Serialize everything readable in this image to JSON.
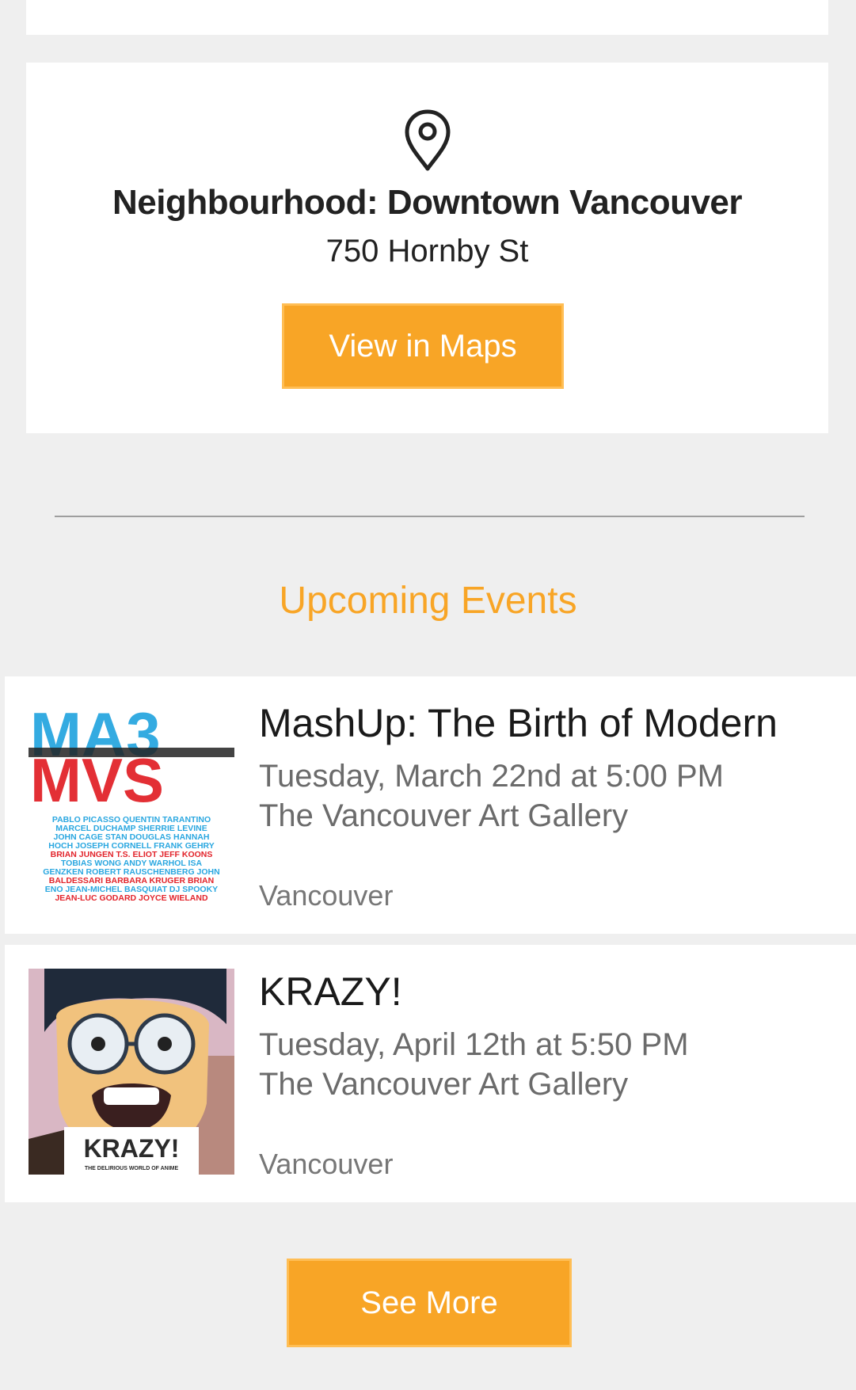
{
  "location": {
    "icon": "map-pin-icon",
    "neighbourhood": "Neighbourhood: Downtown Vancouver",
    "address": "750 Hornby St",
    "maps_button": "View in Maps"
  },
  "upcoming": {
    "title": "Upcoming Events",
    "events": [
      {
        "title": "MashUp: The Birth of Modern",
        "date": "Tuesday, March 22nd at 5:00 PM",
        "venue": "The Vancouver Art Gallery",
        "city": "Vancouver",
        "poster": {
          "logo_top": "MA3",
          "logo_bottom": "MVS",
          "names": [
            "PABLO PICASSO QUENTIN TARANTINO",
            "MARCEL DUCHAMP SHERRIE LEVINE",
            "JOHN CAGE STAN DOUGLAS HANNAH",
            "HOCH JOSEPH CORNELL FRANK GEHRY",
            "BRIAN JUNGEN T.S. ELIOT JEFF KOONS",
            "TOBIAS WONG ANDY WARHOL ISA",
            "GENZKEN ROBERT RAUSCHENBERG JOHN",
            "BALDESSARI BARBARA KRUGER BRIAN",
            "ENO JEAN-MICHEL BASQUIAT DJ SPOOKY",
            "JEAN-LUC GODARD JOYCE WIELAND"
          ]
        }
      },
      {
        "title": "KRAZY!",
        "date": "Tuesday, April 12th at 5:50 PM",
        "venue": "The Vancouver Art Gallery",
        "city": "Vancouver",
        "poster": {
          "headline": "KRAZY!",
          "subline": "THE DELIRIOUS WORLD OF ANIME"
        }
      }
    ],
    "see_more_button": "See More"
  },
  "colors": {
    "accent": "#f8a526",
    "background": "#efefef",
    "card": "#ffffff"
  }
}
